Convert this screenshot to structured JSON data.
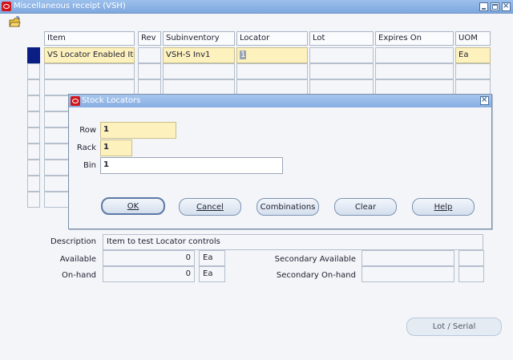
{
  "window": {
    "title": "Miscellaneous receipt (VSH)"
  },
  "grid": {
    "headers": [
      "Item",
      "Rev",
      "Subinventory",
      "Locator",
      "Lot",
      "Expires On",
      "UOM"
    ],
    "first_row": {
      "item": "VS Locator Enabled Ite",
      "rev": "",
      "subinventory": "VSH-S Inv1",
      "locator": "1",
      "lot": "",
      "expires_on": "",
      "uom": "Ea"
    }
  },
  "form": {
    "description_label": "Description",
    "description_value": "Item to test Locator controls",
    "available_label": "Available",
    "available_value": "0",
    "available_uom": "Ea",
    "onhand_label": "On-hand",
    "onhand_value": "0",
    "onhand_uom": "Ea",
    "secondary_available_label": "Secondary Available",
    "secondary_onhand_label": "Secondary On-hand",
    "lot_serial_button": "Lot / Serial"
  },
  "dialog": {
    "title": "Stock Locators",
    "row_label": "Row",
    "row_value": "1",
    "rack_label": "Rack",
    "rack_value": "1",
    "bin_label": "Bin",
    "bin_value": "1",
    "ok_label": "OK",
    "cancel_label": "Cancel",
    "combinations_label": "Combinations",
    "clear_label": "Clear",
    "help_label": "Help"
  },
  "colors": {
    "title_bar": "#86aee2",
    "required_field": "#fdf1be",
    "current_record": "#0a1e84"
  }
}
